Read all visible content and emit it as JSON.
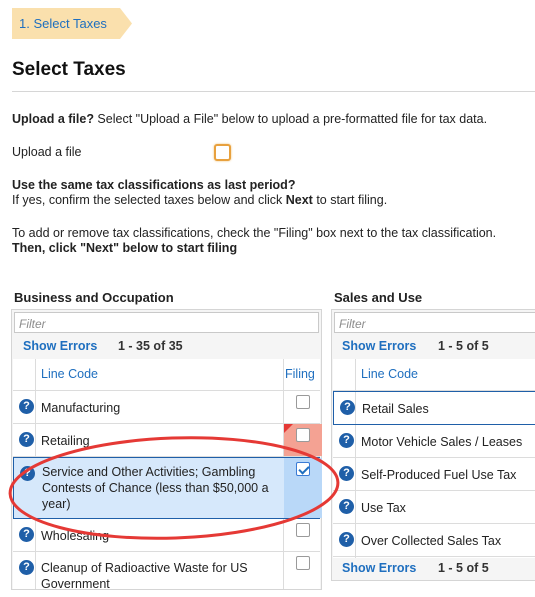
{
  "step_tab": {
    "label": "1. Select Taxes"
  },
  "page": {
    "title": "Select Taxes",
    "upload_q_bold": "Upload a file?",
    "upload_q_rest": " Select \"Upload a File\" below to upload a pre-formatted file for tax data.",
    "upload_label": "Upload a file",
    "same_q": "Use the same tax classifications as last period?",
    "confirm_pre": "If yes, confirm the selected taxes below and click ",
    "confirm_next": "Next",
    "confirm_post": " to start filing.",
    "add_remove": "To add or remove tax classifications, check the \"Filing\" box next to the tax classification.",
    "then_click": "Then, click \"Next\" below to start filing"
  },
  "bo_panel": {
    "title": "Business and Occupation",
    "filter_placeholder": "Filter",
    "show_errors": "Show Errors",
    "count": "1 - 35 of 35",
    "col_line_code": "Line Code",
    "col_filing": "Filing",
    "rows": [
      {
        "label": "Manufacturing",
        "checked": false
      },
      {
        "label": "Retailing",
        "checked": false,
        "error": true
      },
      {
        "label": "Service and Other Activities; Gambling Contests of Chance (less than $50,000 a year)",
        "checked": true
      },
      {
        "label": "Wholesaling",
        "checked": false
      },
      {
        "label": "Cleanup of Radioactive Waste for US Government",
        "checked": false
      }
    ]
  },
  "su_panel": {
    "title": "Sales and Use",
    "filter_placeholder": "Filter",
    "show_errors": "Show Errors",
    "count": "1 - 5 of 5",
    "col_line_code": "Line Code",
    "rows": [
      {
        "label": "Retail Sales"
      },
      {
        "label": "Motor Vehicle Sales / Leases"
      },
      {
        "label": "Self-Produced Fuel Use Tax"
      },
      {
        "label": "Use Tax"
      },
      {
        "label": "Over Collected Sales Tax"
      }
    ],
    "footer_show_errors": "Show Errors",
    "footer_count": "1 - 5 of 5"
  },
  "icons": {
    "help": "question-circle-icon",
    "check": "checkmark-icon"
  },
  "colors": {
    "link_blue": "#1f6fbf",
    "step_bg": "#fae0ad",
    "checked_row_bg": "#d6e8fb",
    "error_cell_bg": "#f4a293",
    "annotation_red": "#e53935",
    "upload_checkbox_border": "#e8a13e"
  }
}
